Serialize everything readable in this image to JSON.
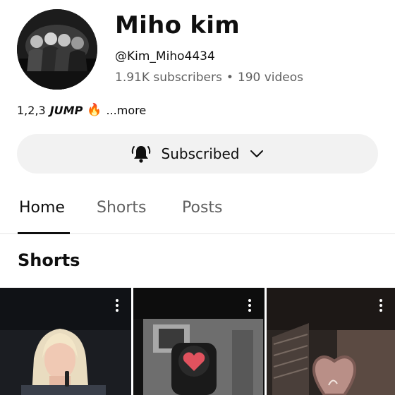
{
  "channel": {
    "name": "Miho kim",
    "handle": "@Kim_Miho4434",
    "subscribers": "1.91K subscribers",
    "separator": "•",
    "videos": "190 videos"
  },
  "description": {
    "prefix": "1,2,3",
    "emphasis": "JUMP",
    "emoji": "🔥",
    "more": "...more"
  },
  "subscribe_button": {
    "label": "Subscribed",
    "icon": "bell-ringing-icon",
    "chevron": "chevron-down-icon"
  },
  "tabs": [
    {
      "label": "Home",
      "active": true
    },
    {
      "label": "Shorts",
      "active": false
    },
    {
      "label": "Posts",
      "active": false
    }
  ],
  "section": {
    "title": "Shorts"
  },
  "shorts": [
    {
      "thumbnail": "singer-blonde-hair-icon",
      "menu_icon": "more-vertical-icon"
    },
    {
      "thumbnail": "traffic-light-heart-icon",
      "menu_icon": "more-vertical-icon"
    },
    {
      "thumbnail": "heart-sign-icon",
      "menu_icon": "more-vertical-icon"
    }
  ],
  "colors": {
    "text_primary": "#0f0f0f",
    "text_secondary": "#606060",
    "button_bg": "#f2f2f2",
    "divider": "#e5e5e5"
  }
}
